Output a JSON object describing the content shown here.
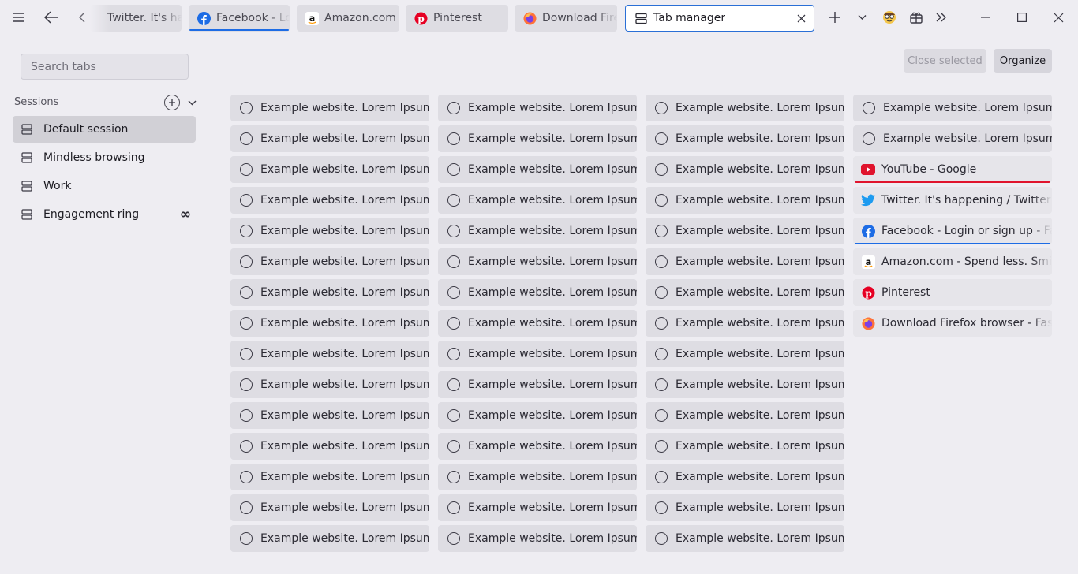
{
  "titlebar": {
    "tabs": [
      {
        "title": "Twitter. It's happening / Twitter",
        "icon": "twitter-icon"
      },
      {
        "title": "Facebook - Login or sign up",
        "icon": "facebook-icon"
      },
      {
        "title": "Amazon.com",
        "icon": "amazon-icon"
      },
      {
        "title": "Pinterest",
        "icon": "pinterest-icon"
      },
      {
        "title": "Download Firefox",
        "icon": "firefox-icon"
      },
      {
        "title": "Tab manager",
        "icon": "tab-manager-icon"
      }
    ]
  },
  "sidebar": {
    "search_placeholder": "Search tabs",
    "sessions_label": "Sessions",
    "sessions": [
      {
        "label": "Default session",
        "selected": true
      },
      {
        "label": "Mindless browsing"
      },
      {
        "label": "Work"
      },
      {
        "label": "Engagement ring",
        "badge": "∞"
      }
    ]
  },
  "main": {
    "close_selected_label": "Close selected",
    "organize_label": "Organize",
    "placeholder_text": "Example website. Lorem Ipsum",
    "columns": [
      [
        "Example website. Lorem Ipsum",
        "Example website. Lorem Ipsum",
        "Example website. Lorem Ipsum",
        "Example website. Lorem Ipsum",
        "Example website. Lorem Ipsum",
        "Example website. Lorem Ipsum",
        "Example website. Lorem Ipsum",
        "Example website. Lorem Ipsum",
        "Example website. Lorem Ipsum",
        "Example website. Lorem Ipsum",
        "Example website. Lorem Ipsum",
        "Example website. Lorem Ipsum",
        "Example website. Lorem Ipsum",
        "Example website. Lorem Ipsum",
        "Example website. Lorem Ipsum"
      ],
      [
        "Example website. Lorem Ipsum",
        "Example website. Lorem Ipsum",
        "Example website. Lorem Ipsum",
        "Example website. Lorem Ipsum",
        "Example website. Lorem Ipsum",
        "Example website. Lorem Ipsum",
        "Example website. Lorem Ipsum",
        "Example website. Lorem Ipsum",
        "Example website. Lorem Ipsum",
        "Example website. Lorem Ipsum",
        "Example website. Lorem Ipsum",
        "Example website. Lorem Ipsum",
        "Example website. Lorem Ipsum",
        "Example website. Lorem Ipsum",
        "Example website. Lorem Ipsum"
      ],
      [
        "Example website. Lorem Ipsum",
        "Example website. Lorem Ipsum",
        "Example website. Lorem Ipsum",
        "Example website. Lorem Ipsum",
        "Example website. Lorem Ipsum",
        "Example website. Lorem Ipsum",
        "Example website. Lorem Ipsum",
        "Example website. Lorem Ipsum",
        "Example website. Lorem Ipsum",
        "Example website. Lorem Ipsum",
        "Example website. Lorem Ipsum",
        "Example website. Lorem Ipsum",
        "Example website. Lorem Ipsum",
        "Example website. Lorem Ipsum",
        "Example website. Lorem Ipsum"
      ]
    ],
    "last_column": [
      {
        "title": "Example website. Lorem Ipsum",
        "kind": "placeholder"
      },
      {
        "title": "Example website. Lorem Ipsum",
        "kind": "placeholder"
      },
      {
        "title": "YouTube - Google",
        "kind": "live",
        "icon": "youtube-icon"
      },
      {
        "title": "Twitter. It's happening / Twitter",
        "kind": "live",
        "icon": "twitter-icon"
      },
      {
        "title": "Facebook - Login or sign up - Facebook",
        "kind": "live",
        "icon": "facebook-icon"
      },
      {
        "title": "Amazon.com - Spend less. Smile more.",
        "kind": "live",
        "icon": "amazon-icon"
      },
      {
        "title": "Pinterest",
        "kind": "live",
        "icon": "pinterest-icon"
      },
      {
        "title": "Download Firefox browser - Fast, Private & Free",
        "kind": "live",
        "icon": "firefox-icon"
      }
    ]
  },
  "colors": {
    "accent": "#2a6fd6",
    "youtube": "#e0142d",
    "facebook": "#1d6ce5",
    "twitter": "#1d9bf0",
    "pinterest": "#e60023",
    "firefox": "#ff7139"
  }
}
